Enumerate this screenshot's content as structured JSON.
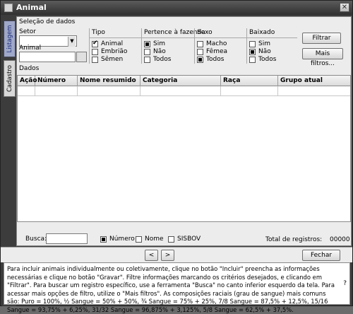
{
  "window": {
    "title": "Animal",
    "close_label": "✕"
  },
  "tabs": [
    {
      "label": "Listagem",
      "active": true
    },
    {
      "label": "Cadastro",
      "active": false
    }
  ],
  "selection": {
    "section_label": "Seleção de dados",
    "setor_label": "Setor",
    "setor_value": "",
    "animal_label": "Animal",
    "animal_value": "",
    "groups": [
      {
        "title": "Tipo",
        "options": [
          {
            "label": "Animal",
            "state": "checked"
          },
          {
            "label": "Embrião",
            "state": "unchecked"
          },
          {
            "label": "Sêmen",
            "state": "unchecked"
          }
        ]
      },
      {
        "title": "Pertence à fazenda",
        "options": [
          {
            "label": "Sim",
            "state": "selected"
          },
          {
            "label": "Não",
            "state": "unchecked"
          },
          {
            "label": "Todos",
            "state": "unchecked"
          }
        ]
      },
      {
        "title": "Sexo",
        "options": [
          {
            "label": "Macho",
            "state": "unchecked"
          },
          {
            "label": "Fêmea",
            "state": "unchecked"
          },
          {
            "label": "Todos",
            "state": "selected"
          }
        ]
      },
      {
        "title": "Baixado",
        "options": [
          {
            "label": "Sim",
            "state": "unchecked"
          },
          {
            "label": "Não",
            "state": "selected"
          },
          {
            "label": "Todos",
            "state": "unchecked"
          }
        ]
      }
    ],
    "filter_button": "Filtrar",
    "more_filters_button": "Mais filtros..."
  },
  "data_section": {
    "label": "Dados",
    "columns": [
      "Ação",
      "Número",
      "Nome resumido",
      "Categoria",
      "Raça",
      "Grupo atual"
    ],
    "rows": []
  },
  "search": {
    "label": "Busca:",
    "value": "",
    "options": [
      {
        "label": "Número",
        "state": "selected"
      },
      {
        "label": "Nome",
        "state": "unchecked"
      },
      {
        "label": "SISBOV",
        "state": "unchecked"
      }
    ],
    "total_label": "Total de registros:",
    "total_value": "00000"
  },
  "nav": {
    "prev": "<",
    "next": ">",
    "close_button": "Fechar"
  },
  "help_text": "Para incluir animais individualmente ou coletivamente, clique no botão \"Incluir\" preencha as informações necessárias e clique no botão \"Gravar\". Filtre informações marcando os critérios desejados, e clicando em \"Filtrar\". Para buscar um registro específico, use a ferramenta \"Busca\" no canto inferior esquerdo da tela. Para acessar mais opções de filtro, utilize o \"Mais filtros\". As composições raciais (grau de sangue) mais comuns são: Puro = 100%, ½ Sangue = 50% + 50%, ¾ Sangue = 75% + 25%, 7/8 Sangue = 87,5% + 12,5%, 15/16 Sangue = 93,75% + 6,25%, 31/32 Sangue = 96,875% + 3,125%, 5/8 Sangue = 62,5% + 37,5%.",
  "help_icon": "?"
}
